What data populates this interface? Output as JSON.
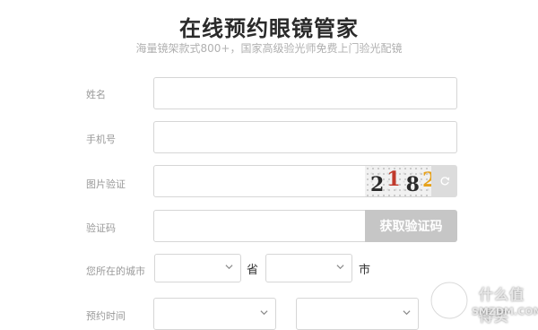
{
  "header": {
    "title": "在线预约眼镜管家",
    "subtitle": "海量镜架款式800+，国家高级验光师免费上门验光配镜"
  },
  "form": {
    "name_label": "姓名",
    "name_value": "",
    "phone_label": "手机号",
    "phone_value": "",
    "image_captcha_label": "图片验证",
    "image_captcha_value": "",
    "captcha_digits": [
      {
        "char": "2",
        "color": "#2a2a2a"
      },
      {
        "char": "1",
        "color": "#c0392b"
      },
      {
        "char": "8",
        "color": "#2a2a2a"
      },
      {
        "char": "2",
        "color": "#e6a11a"
      }
    ],
    "refresh_icon": "refresh-icon",
    "sms_code_label": "验证码",
    "sms_code_value": "",
    "get_code_label": "获取验证码",
    "city_label": "您所在的城市",
    "province_suffix": "省",
    "city_suffix": "市",
    "province_value": "",
    "city_value": "",
    "appointment_label": "预约时间",
    "date_value": "",
    "time_value": ""
  },
  "watermark": {
    "text_main": "什么值得买",
    "text_sub": "SMZDM.COM"
  },
  "colors": {
    "border": "#d6d6d6",
    "label": "#9a9a9a",
    "button_disabled": "#c6c6c6"
  }
}
